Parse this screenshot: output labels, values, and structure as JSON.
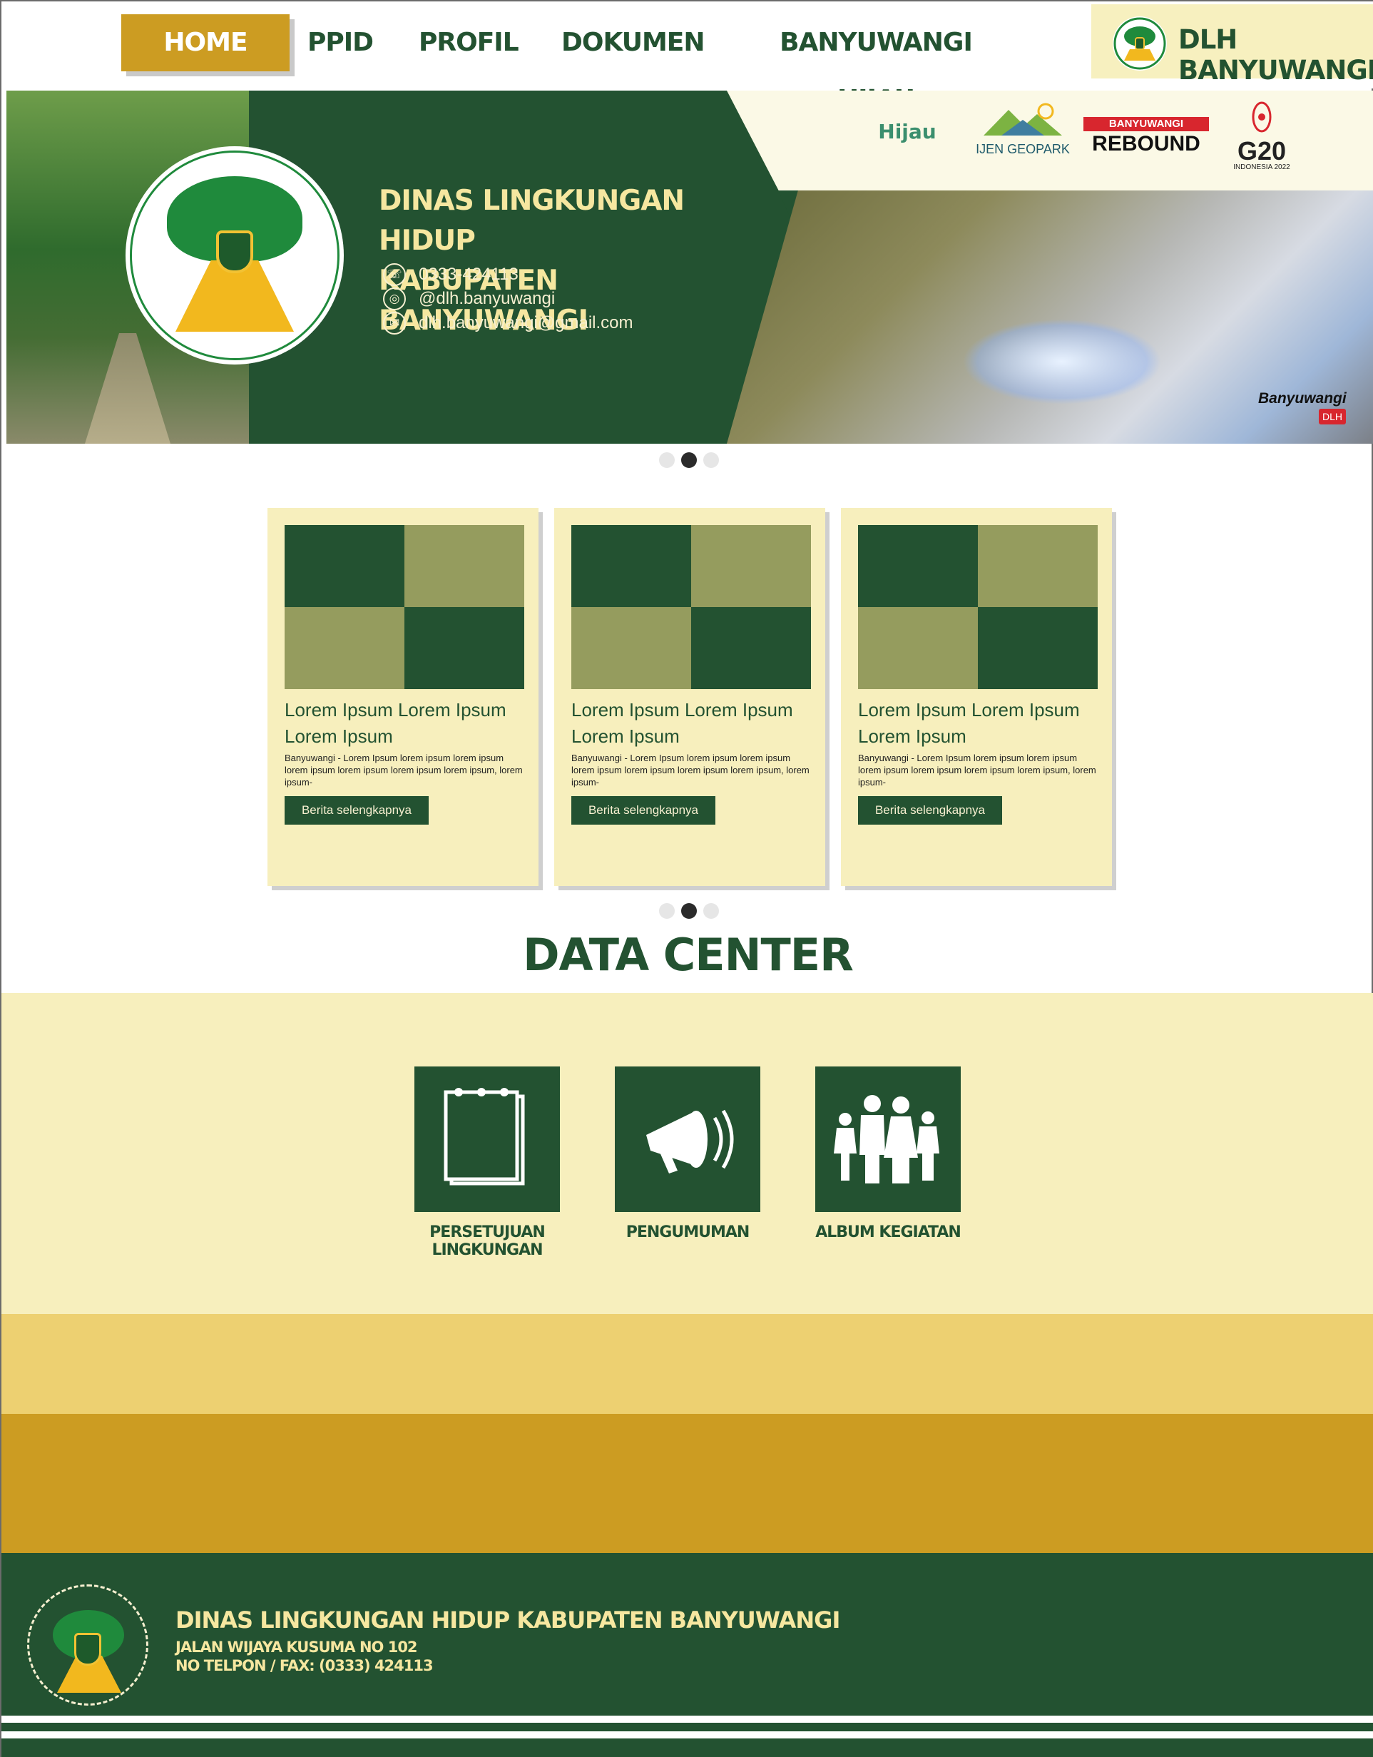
{
  "nav": {
    "items": [
      "HOME",
      "PPID",
      "PROFIL",
      "DOKUMEN",
      "BANYUWANGI HIJAU"
    ],
    "brand": "DLH BANYUWANGI"
  },
  "hero": {
    "title_line1": "DINAS LINGKUNGAN HIDUP",
    "title_line2": "KABUPATEN BANYUWANGI",
    "phone": "0333-424113",
    "instagram": "@dlh.banyuwangi",
    "email": "dlh.banyuwangi@gmail.com",
    "partners": {
      "hijau": "Hijau",
      "ijen": "IJEN GEOPARK",
      "rebound_top": "BANYUWANGI",
      "rebound": "REBOUND",
      "g20": "G20",
      "g20_sub": "INDONESIA 2022"
    },
    "watermark": "Banyuwangi",
    "watermark_sub": "DLH",
    "slide_count": 3,
    "active_slide": 2
  },
  "news": {
    "cards": [
      {
        "title": "Lorem Ipsum Lorem Ipsum Lorem Ipsum",
        "excerpt": "Banyuwangi - Lorem Ipsum lorem ipsum lorem ipsum lorem ipsum lorem ipsum lorem ipsum lorem ipsum, lorem ipsum-",
        "button": "Berita selengkapnya"
      },
      {
        "title": "Lorem Ipsum Lorem Ipsum Lorem Ipsum",
        "excerpt": "Banyuwangi - Lorem Ipsum lorem ipsum lorem ipsum lorem ipsum lorem ipsum lorem ipsum lorem ipsum, lorem ipsum-",
        "button": "Berita selengkapnya"
      },
      {
        "title": "Lorem Ipsum Lorem Ipsum Lorem Ipsum",
        "excerpt": "Banyuwangi - Lorem Ipsum lorem ipsum lorem ipsum lorem ipsum lorem ipsum lorem ipsum lorem ipsum, lorem ipsum-",
        "button": "Berita selengkapnya"
      }
    ],
    "active_slide": 2
  },
  "data_center": {
    "title": "DATA CENTER",
    "items": [
      {
        "label": "PERSETUJUAN LINGKUNGAN",
        "icon": "notepad-icon"
      },
      {
        "label": "PENGUMUMAN",
        "icon": "megaphone-icon"
      },
      {
        "label": "ALBUM KEGIATAN",
        "icon": "family-icon"
      }
    ]
  },
  "footer": {
    "name": "DINAS LINGKUNGAN HIDUP KABUPATEN BANYUWANGI",
    "address": "JALAN WIJAYA KUSUMA NO 102",
    "phone": "NO TELPON / FAX: (0333) 424113"
  },
  "colors": {
    "primary_green": "#235231",
    "gold": "#cc9c22",
    "cream": "#f7efbd",
    "yellow": "#edd071",
    "olive": "#959c5e"
  }
}
